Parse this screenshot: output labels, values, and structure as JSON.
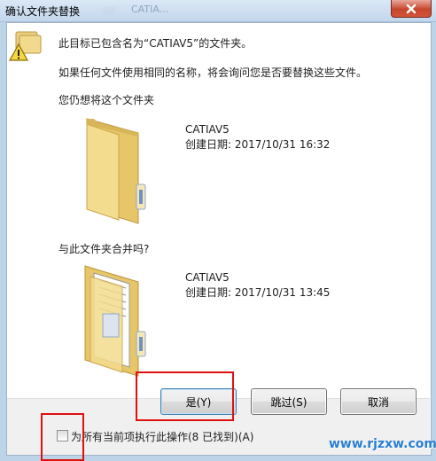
{
  "window": {
    "title": "确认文件夹替换",
    "background_title": "CATIA...",
    "close_icon": "close-icon"
  },
  "message": {
    "line1": "此目标已包含名为“CATIAV5”的文件夹。",
    "line2": "如果任何文件使用相同的名称，将会询问您是否要替换这些文件。",
    "keep_prompt": "您仍想将这个文件夹",
    "merge_prompt": "与此文件夹合并吗?"
  },
  "target_folder": {
    "name": "CATIAV5",
    "created": "创建日期: 2017/10/31 16:32"
  },
  "source_folder": {
    "name": "CATIAV5",
    "created": "创建日期: 2017/10/31 13:45"
  },
  "buttons": {
    "yes": "是(Y)",
    "skip": "跳过(S)",
    "cancel": "取消"
  },
  "apply_all": {
    "label": "为所有当前项执行此操作(8 已找到)(A)",
    "checked": false
  },
  "watermark": "www.rjzxw.com",
  "colors": {
    "highlight": "#e01010",
    "folder": "#f3d27a",
    "watermark": "#2a7fd4"
  }
}
